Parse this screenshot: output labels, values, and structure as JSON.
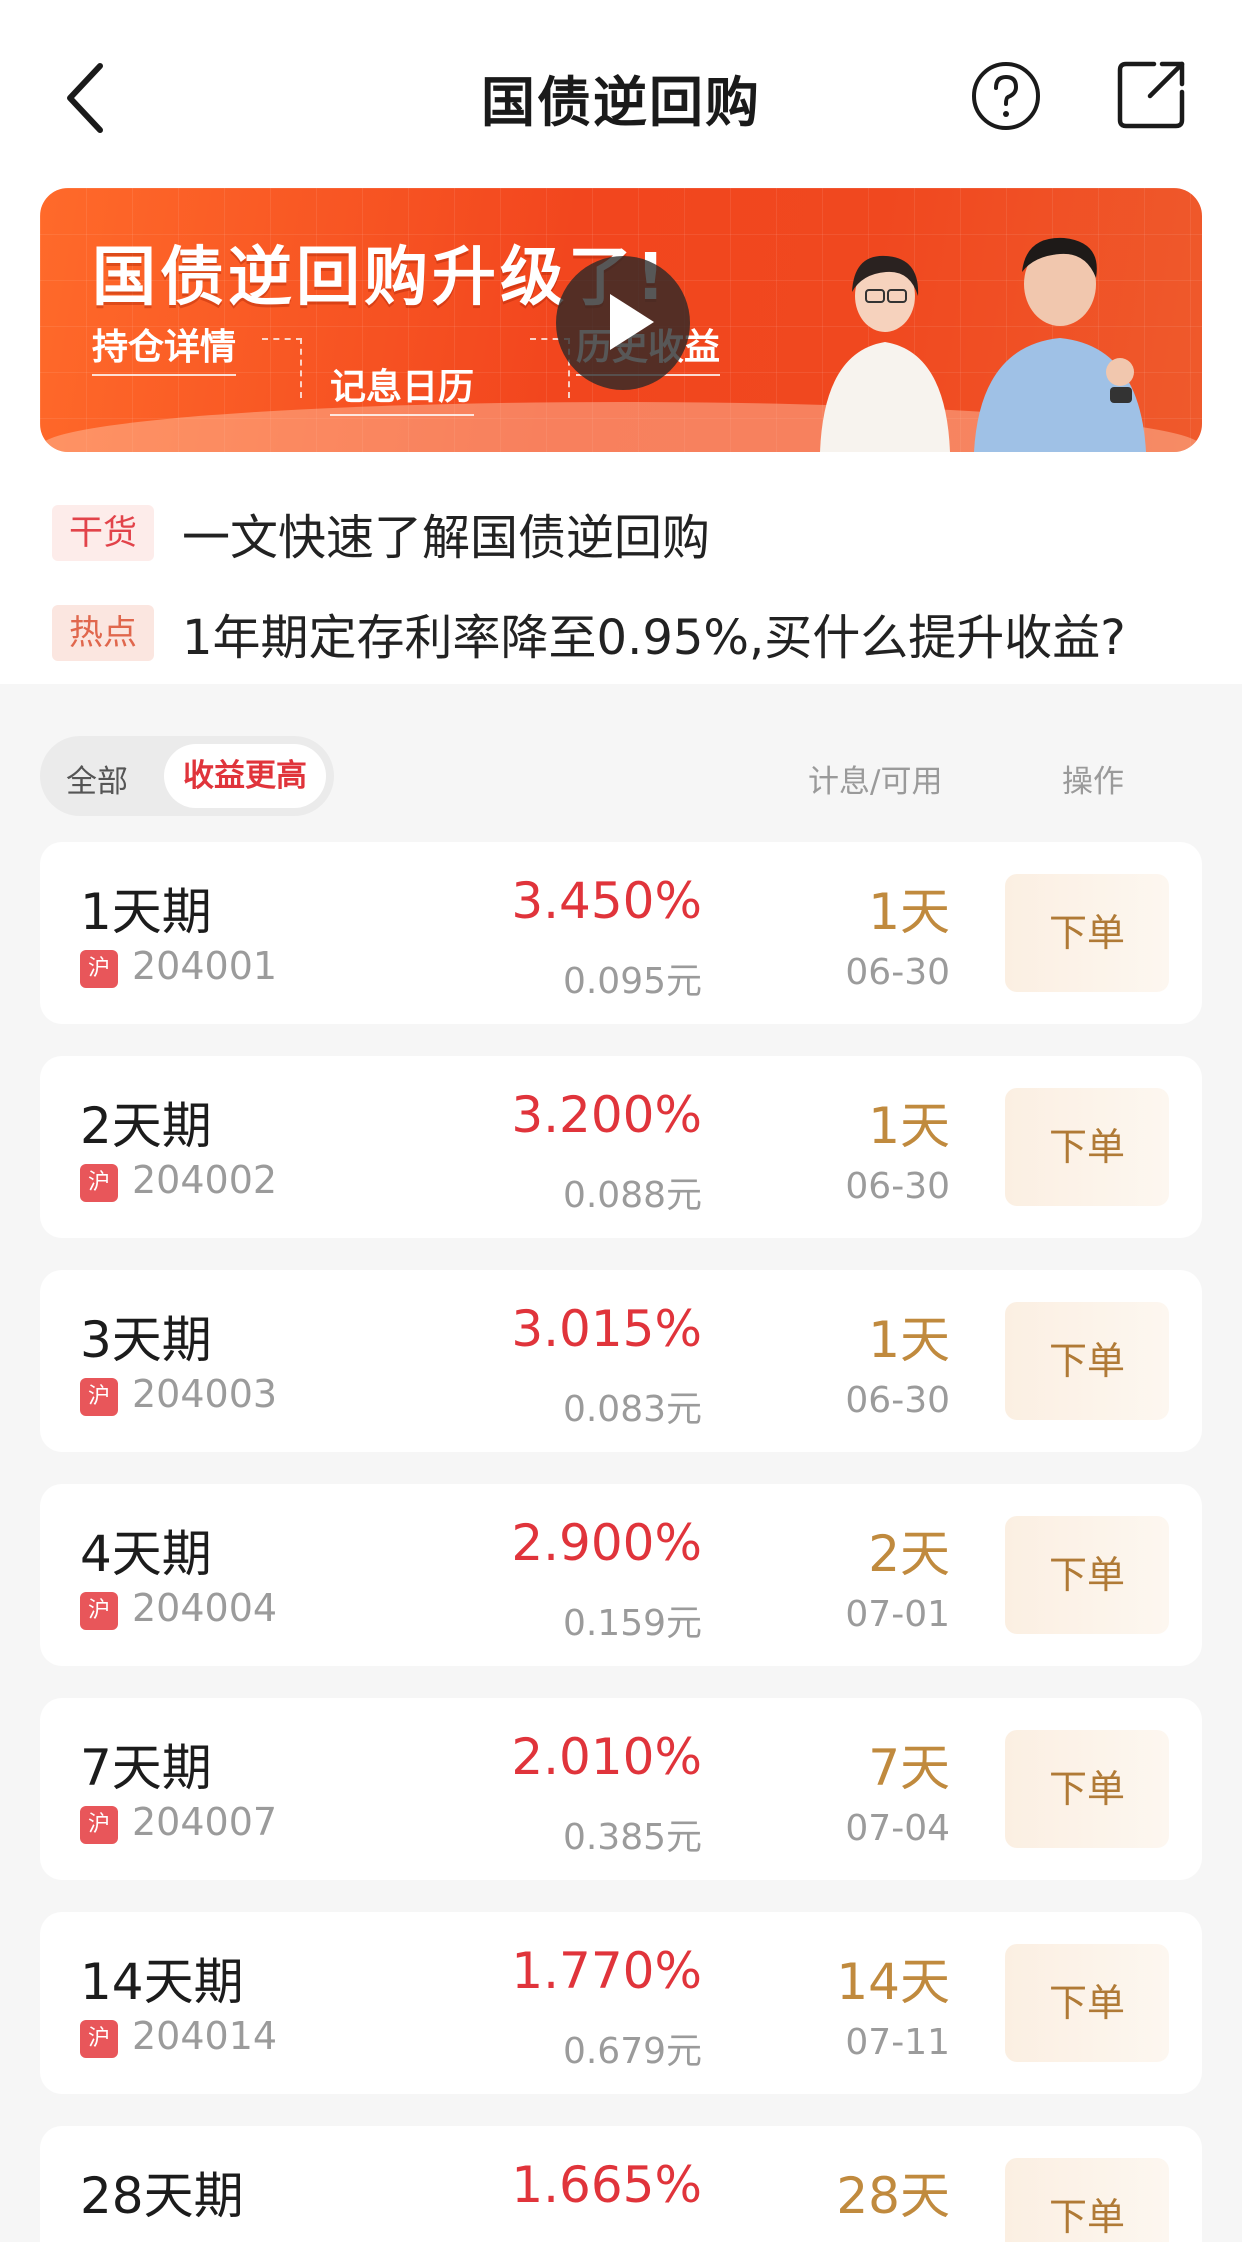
{
  "nav": {
    "title": "国债逆回购",
    "back_icon": "chevron-left-icon",
    "help_icon": "question-circle-icon",
    "share_icon": "share-external-icon"
  },
  "banner": {
    "title": "国债逆回购升级了!",
    "tags": [
      "持仓详情",
      "记息日历",
      "历史收益"
    ],
    "accent": "#f2461e"
  },
  "news": [
    {
      "badge": "干货",
      "text": "一文快速了解国债逆回购"
    },
    {
      "badge": "热点",
      "text": "1年期定存利率降至0.95%,买什么提升收益?"
    }
  ],
  "filters": {
    "all": "全部",
    "yield": "收益更高",
    "col_interest": "计息/可用",
    "col_operation": "操作"
  },
  "products": [
    {
      "name": "1天期",
      "market": "沪",
      "code": "204001",
      "rate": "3.450%",
      "income": "0.095元",
      "days": "1天",
      "date": "06-30",
      "action": "下单"
    },
    {
      "name": "2天期",
      "market": "沪",
      "code": "204002",
      "rate": "3.200%",
      "income": "0.088元",
      "days": "1天",
      "date": "06-30",
      "action": "下单"
    },
    {
      "name": "3天期",
      "market": "沪",
      "code": "204003",
      "rate": "3.015%",
      "income": "0.083元",
      "days": "1天",
      "date": "06-30",
      "action": "下单"
    },
    {
      "name": "4天期",
      "market": "沪",
      "code": "204004",
      "rate": "2.900%",
      "income": "0.159元",
      "days": "2天",
      "date": "07-01",
      "action": "下单"
    },
    {
      "name": "7天期",
      "market": "沪",
      "code": "204007",
      "rate": "2.010%",
      "income": "0.385元",
      "days": "7天",
      "date": "07-04",
      "action": "下单"
    },
    {
      "name": "14天期",
      "market": "沪",
      "code": "204014",
      "rate": "1.770%",
      "income": "0.679元",
      "days": "14天",
      "date": "07-11",
      "action": "下单"
    },
    {
      "name": "28天期",
      "market": "",
      "code": "",
      "rate": "1.665%",
      "income": "",
      "days": "28天",
      "date": "",
      "action": "下单"
    }
  ]
}
